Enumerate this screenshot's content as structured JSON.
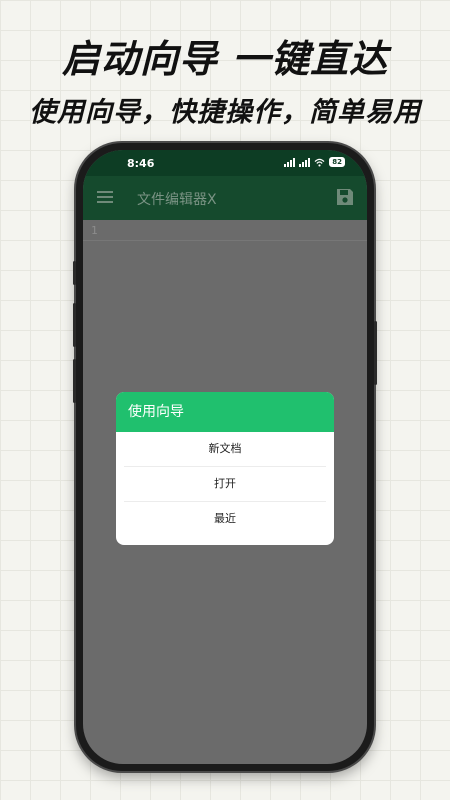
{
  "promo": {
    "headline": "启动向导  一键直达",
    "subline": "使用向导，快捷操作，简单易用"
  },
  "status_bar": {
    "time": "8:46",
    "battery": "82"
  },
  "toolbar": {
    "title": "文件编辑器X",
    "menu_icon": "hamburger-menu-icon",
    "save_icon": "floppy-save-icon"
  },
  "editor": {
    "line_number": "1"
  },
  "dialog": {
    "title": "使用向导",
    "items": [
      "新文档",
      "打开",
      "最近"
    ]
  },
  "colors": {
    "accent": "#20c06e",
    "toolbar": "#154a2d",
    "status_bar": "#0d3d24",
    "overlay": "#6b6b6b"
  }
}
